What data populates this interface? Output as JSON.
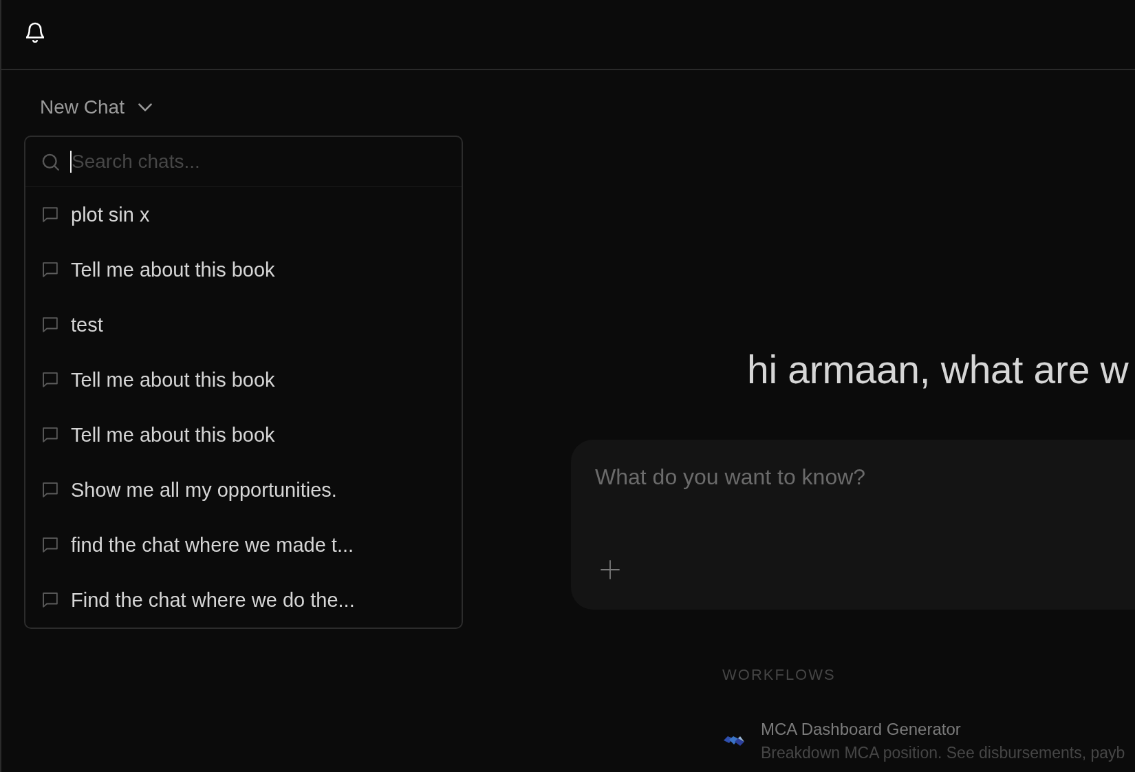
{
  "chat_menu": {
    "label": "New Chat",
    "expanded": true,
    "search": {
      "placeholder": "Search chats...",
      "focused": true
    },
    "chats": [
      {
        "title": "plot sin x"
      },
      {
        "title": "Tell me about this book"
      },
      {
        "title": "test"
      },
      {
        "title": "Tell me about this book"
      },
      {
        "title": "Tell me about this book"
      },
      {
        "title": "Show me all my opportunities."
      },
      {
        "title": "find the chat where we made t..."
      },
      {
        "title": "Find the chat where we do the..."
      }
    ]
  },
  "main": {
    "greeting": "hi armaan, what are w",
    "prompt": {
      "placeholder": "What do you want to know?"
    },
    "workflows": {
      "heading": "WORKFLOWS",
      "items": [
        {
          "title": "MCA Dashboard Generator",
          "description": "Breakdown MCA position. See disbursements, payb"
        }
      ]
    }
  }
}
